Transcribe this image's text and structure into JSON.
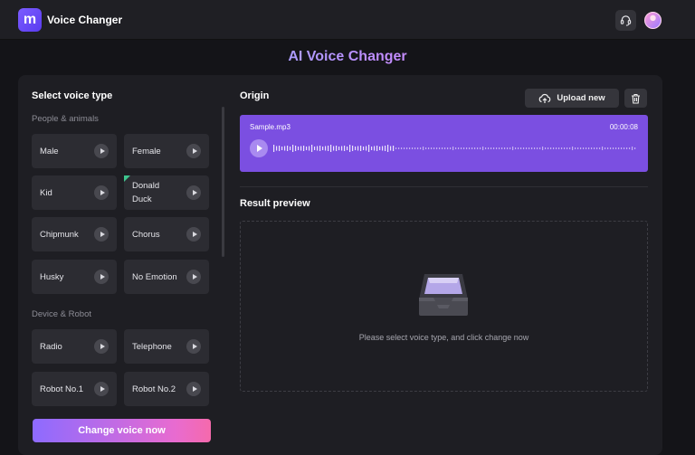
{
  "app": {
    "title": "Voice Changer",
    "logo_letter": "m"
  },
  "header": {
    "title": "AI Voice Changer"
  },
  "left": {
    "title": "Select voice type",
    "categories": [
      {
        "name": "People & animals",
        "voices": [
          "Male",
          "Female",
          "Kid",
          "Donald Duck",
          "Chipmunk",
          "Chorus",
          "Husky",
          "No Emotion"
        ]
      },
      {
        "name": "Device & Robot",
        "voices": [
          "Radio",
          "Telephone",
          "Robot No.1",
          "Robot No.2"
        ]
      }
    ],
    "change_button": "Change voice now"
  },
  "origin": {
    "title": "Origin",
    "upload_label": "Upload new",
    "file_name": "Sample.mp3",
    "duration": "00:00:08"
  },
  "result": {
    "title": "Result preview",
    "empty_message": "Please select voice type, and click change now"
  },
  "colors": {
    "accent": "#7b4fe1",
    "button_gradient_start": "#8d6bff",
    "button_gradient_end": "#f56aac",
    "new_tag": "#3ec58e"
  }
}
